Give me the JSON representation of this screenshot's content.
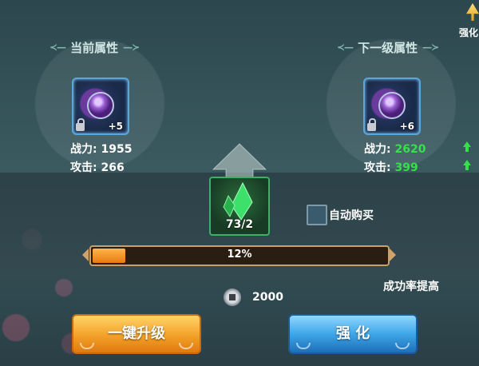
{
  "current": {
    "header": "当前属性",
    "item": {
      "level": "+5",
      "icon": "amulet-icon"
    },
    "stats": {
      "power_label": "战力:",
      "power_value": "1955",
      "attack_label": "攻击:",
      "attack_value": "266"
    }
  },
  "next": {
    "header": "下一级属性",
    "item": {
      "level": "+6",
      "icon": "amulet-icon"
    },
    "stats": {
      "power_label": "战力:",
      "power_value": "2620",
      "attack_label": "攻击:",
      "attack_value": "399"
    }
  },
  "material": {
    "icon": "green-crystal-icon",
    "count": "73/2"
  },
  "auto_buy": {
    "label": "自动购买",
    "checked": false
  },
  "progress": {
    "text": "12%",
    "value": 0.12
  },
  "success_rate_label": "成功率提高",
  "cost": {
    "icon": "silver-coin-icon",
    "amount": "2000"
  },
  "buttons": {
    "one_key": "一键升级",
    "enhance": "强 化"
  },
  "top_right": {
    "label": "强化"
  },
  "colors": {
    "increase": "#35e04a",
    "progress": "#f08c1e",
    "orange_btn": "#f4a52c",
    "blue_btn": "#3fa6e8"
  }
}
